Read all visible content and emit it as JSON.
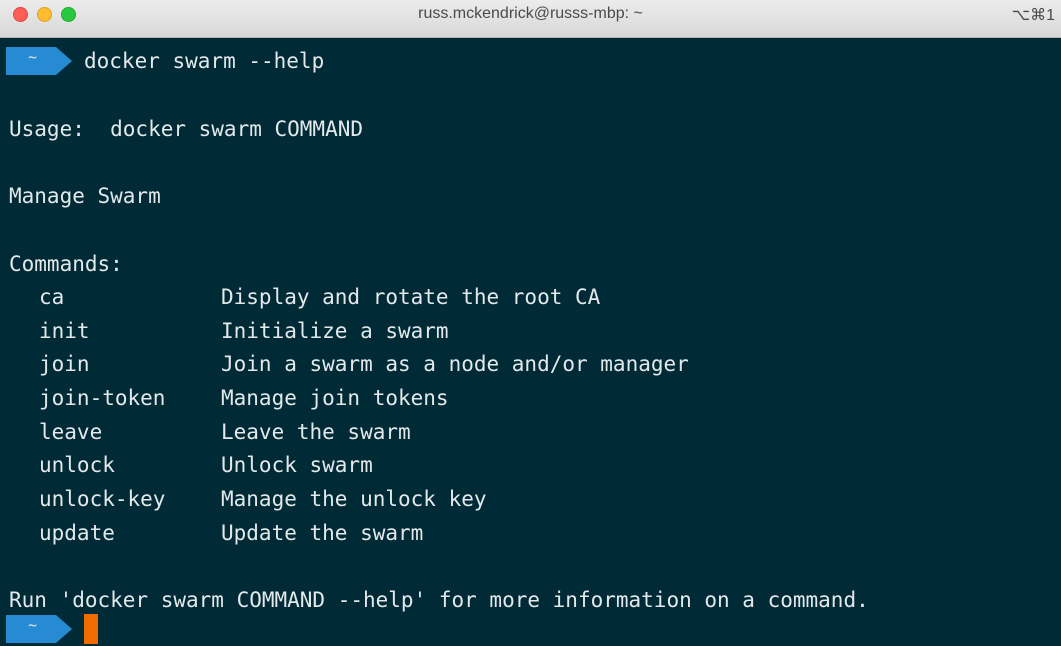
{
  "window": {
    "title": "russ.mckendrick@russs-mbp: ~",
    "shortcut": "⌥⌘1"
  },
  "terminal": {
    "prompt_symbol": "~",
    "command": "docker swarm --help",
    "usage": "Usage:  docker swarm COMMAND",
    "description": "Manage Swarm",
    "commands_header": "Commands:",
    "commands": [
      {
        "name": "ca",
        "desc": "Display and rotate the root CA"
      },
      {
        "name": "init",
        "desc": "Initialize a swarm"
      },
      {
        "name": "join",
        "desc": "Join a swarm as a node and/or manager"
      },
      {
        "name": "join-token",
        "desc": "Manage join tokens"
      },
      {
        "name": "leave",
        "desc": "Leave the swarm"
      },
      {
        "name": "unlock",
        "desc": "Unlock swarm"
      },
      {
        "name": "unlock-key",
        "desc": "Manage the unlock key"
      },
      {
        "name": "update",
        "desc": "Update the swarm"
      }
    ],
    "footer": "Run 'docker swarm COMMAND --help' for more information on a command."
  },
  "colors": {
    "background": "#002b36",
    "prompt_segment": "#268bd2",
    "cursor": "#f06c00",
    "text": "#e3e8ea"
  }
}
